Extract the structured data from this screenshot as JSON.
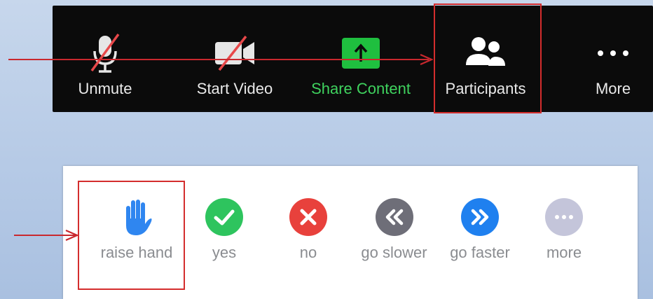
{
  "toolbar": {
    "unmute_label": "Unmute",
    "video_label": "Start Video",
    "share_label": "Share Content",
    "participants_label": "Participants",
    "more_label": "More",
    "icons": {
      "unmute": "microphone-muted-icon",
      "video": "video-off-icon",
      "share": "share-upload-icon",
      "participants": "participants-icon",
      "more": "ellipsis-icon"
    },
    "colors": {
      "background": "#0b0b0b",
      "text": "#e9e9e9",
      "share_text": "#3fd25e",
      "share_icon": "#1fbf3f"
    }
  },
  "reactions": {
    "raise_label": "raise hand",
    "yes_label": "yes",
    "no_label": "no",
    "slower_label": "go slower",
    "faster_label": "go faster",
    "more_label": "more",
    "icons": {
      "raise": "raised-hand-icon",
      "yes": "check-circle-icon",
      "no": "x-circle-icon",
      "slower": "rewind-circle-icon",
      "faster": "fast-forward-circle-icon",
      "more": "ellipsis-circle-icon"
    },
    "colors": {
      "raise": "#2f86f0",
      "yes": "#2ec45e",
      "no": "#e8413c",
      "slower": "#6e6e78",
      "faster": "#1f80ef",
      "more": "#c4c5da"
    }
  },
  "annotations": {
    "highlight_color": "#d42d2d"
  }
}
